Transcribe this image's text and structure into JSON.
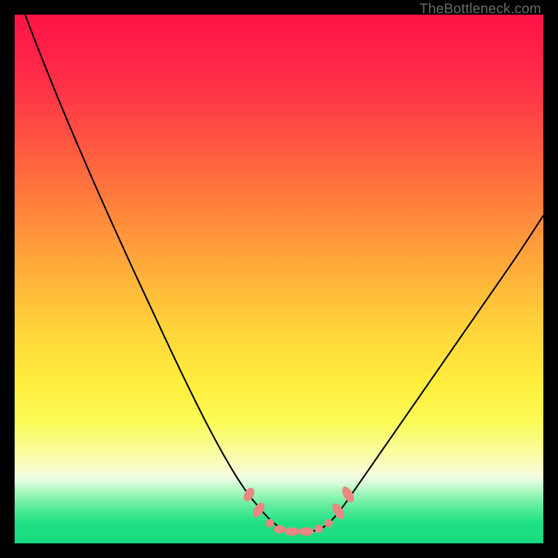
{
  "watermark": "TheBottleneck.com",
  "chart_data": {
    "type": "line",
    "title": "",
    "xlabel": "",
    "ylabel": "",
    "xlim": [
      0,
      100
    ],
    "ylim": [
      0,
      100
    ],
    "background_gradient": {
      "top": "#ff1447",
      "mid": "#ffd63a",
      "bottom": "#18da82"
    },
    "series": [
      {
        "name": "bottleneck-curve",
        "x": [
          2,
          10,
          18,
          26,
          34,
          38,
          42,
          46,
          48,
          50,
          52,
          54,
          56,
          58,
          60,
          64,
          70,
          78,
          86,
          94,
          100
        ],
        "y": [
          100,
          82,
          65,
          48,
          30,
          21,
          12,
          6,
          3.5,
          2.5,
          2,
          2,
          2.2,
          3,
          5,
          11,
          20,
          32,
          44,
          56,
          66
        ]
      }
    ],
    "markers": {
      "name": "highlight-dots",
      "color": "#e98783",
      "points": [
        {
          "x": 44.5,
          "y": 7.5
        },
        {
          "x": 46.5,
          "y": 5
        },
        {
          "x": 48,
          "y": 3.5
        },
        {
          "x": 50,
          "y": 2.5
        },
        {
          "x": 52,
          "y": 2
        },
        {
          "x": 54,
          "y": 2
        },
        {
          "x": 56,
          "y": 2.2
        },
        {
          "x": 58,
          "y": 3
        },
        {
          "x": 60.5,
          "y": 5.5
        },
        {
          "x": 62.5,
          "y": 9
        }
      ]
    }
  }
}
